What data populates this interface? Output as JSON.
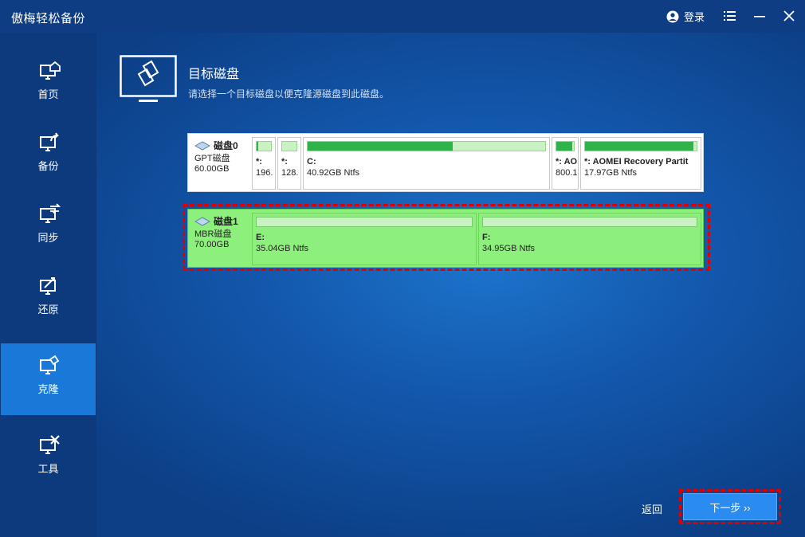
{
  "app": {
    "title": "傲梅轻松备份"
  },
  "titlebar": {
    "login_label": "登录",
    "icons": [
      "user-icon",
      "menu-icon",
      "minimize-icon",
      "close-icon"
    ]
  },
  "sidebar": {
    "items": [
      {
        "label": "首页",
        "icon": "home-icon",
        "active": false
      },
      {
        "label": "备份",
        "icon": "backup-icon",
        "active": false
      },
      {
        "label": "同步",
        "icon": "sync-icon",
        "active": false
      },
      {
        "label": "还原",
        "icon": "restore-icon",
        "active": false
      },
      {
        "label": "克隆",
        "icon": "clone-icon",
        "active": true
      },
      {
        "label": "工具",
        "icon": "tools-icon",
        "active": false
      }
    ]
  },
  "main": {
    "title": "目标磁盘",
    "subtitle": "请选择一个目标磁盘以便克隆源磁盘到此磁盘。"
  },
  "disks": [
    {
      "name": "磁盘0",
      "type": "GPT磁盘",
      "size": "60.00GB",
      "selected": false,
      "partitions": [
        {
          "label": "*:",
          "size": "196.",
          "used_fraction": 0.12
        },
        {
          "label": "*:",
          "size": "128.",
          "used_fraction": 0.0
        },
        {
          "label": "C:",
          "size": "40.92GB Ntfs",
          "used_fraction": 0.61
        },
        {
          "label": "*: AO",
          "size": "800.1",
          "used_fraction": 0.9
        },
        {
          "label": "*: AOMEI Recovery Partit",
          "size": "17.97GB Ntfs",
          "used_fraction": 0.97
        }
      ]
    },
    {
      "name": "磁盘1",
      "type": "MBR磁盘",
      "size": "70.00GB",
      "selected": true,
      "partitions": [
        {
          "label": "E:",
          "size": "35.04GB Ntfs",
          "used_fraction": 0.0
        },
        {
          "label": "F:",
          "size": "34.95GB Ntfs",
          "used_fraction": 0.0
        }
      ]
    }
  ],
  "footer": {
    "back_label": "返回",
    "next_label": "下一步 ››"
  },
  "colors": {
    "sidebar_bg": "#0d3a7c",
    "active_nav": "#1a78d9",
    "selected_disk": "#8ef07c",
    "used_bar": "#2fb24a",
    "next_button": "#2a8cf0",
    "highlight": "#e00000"
  }
}
